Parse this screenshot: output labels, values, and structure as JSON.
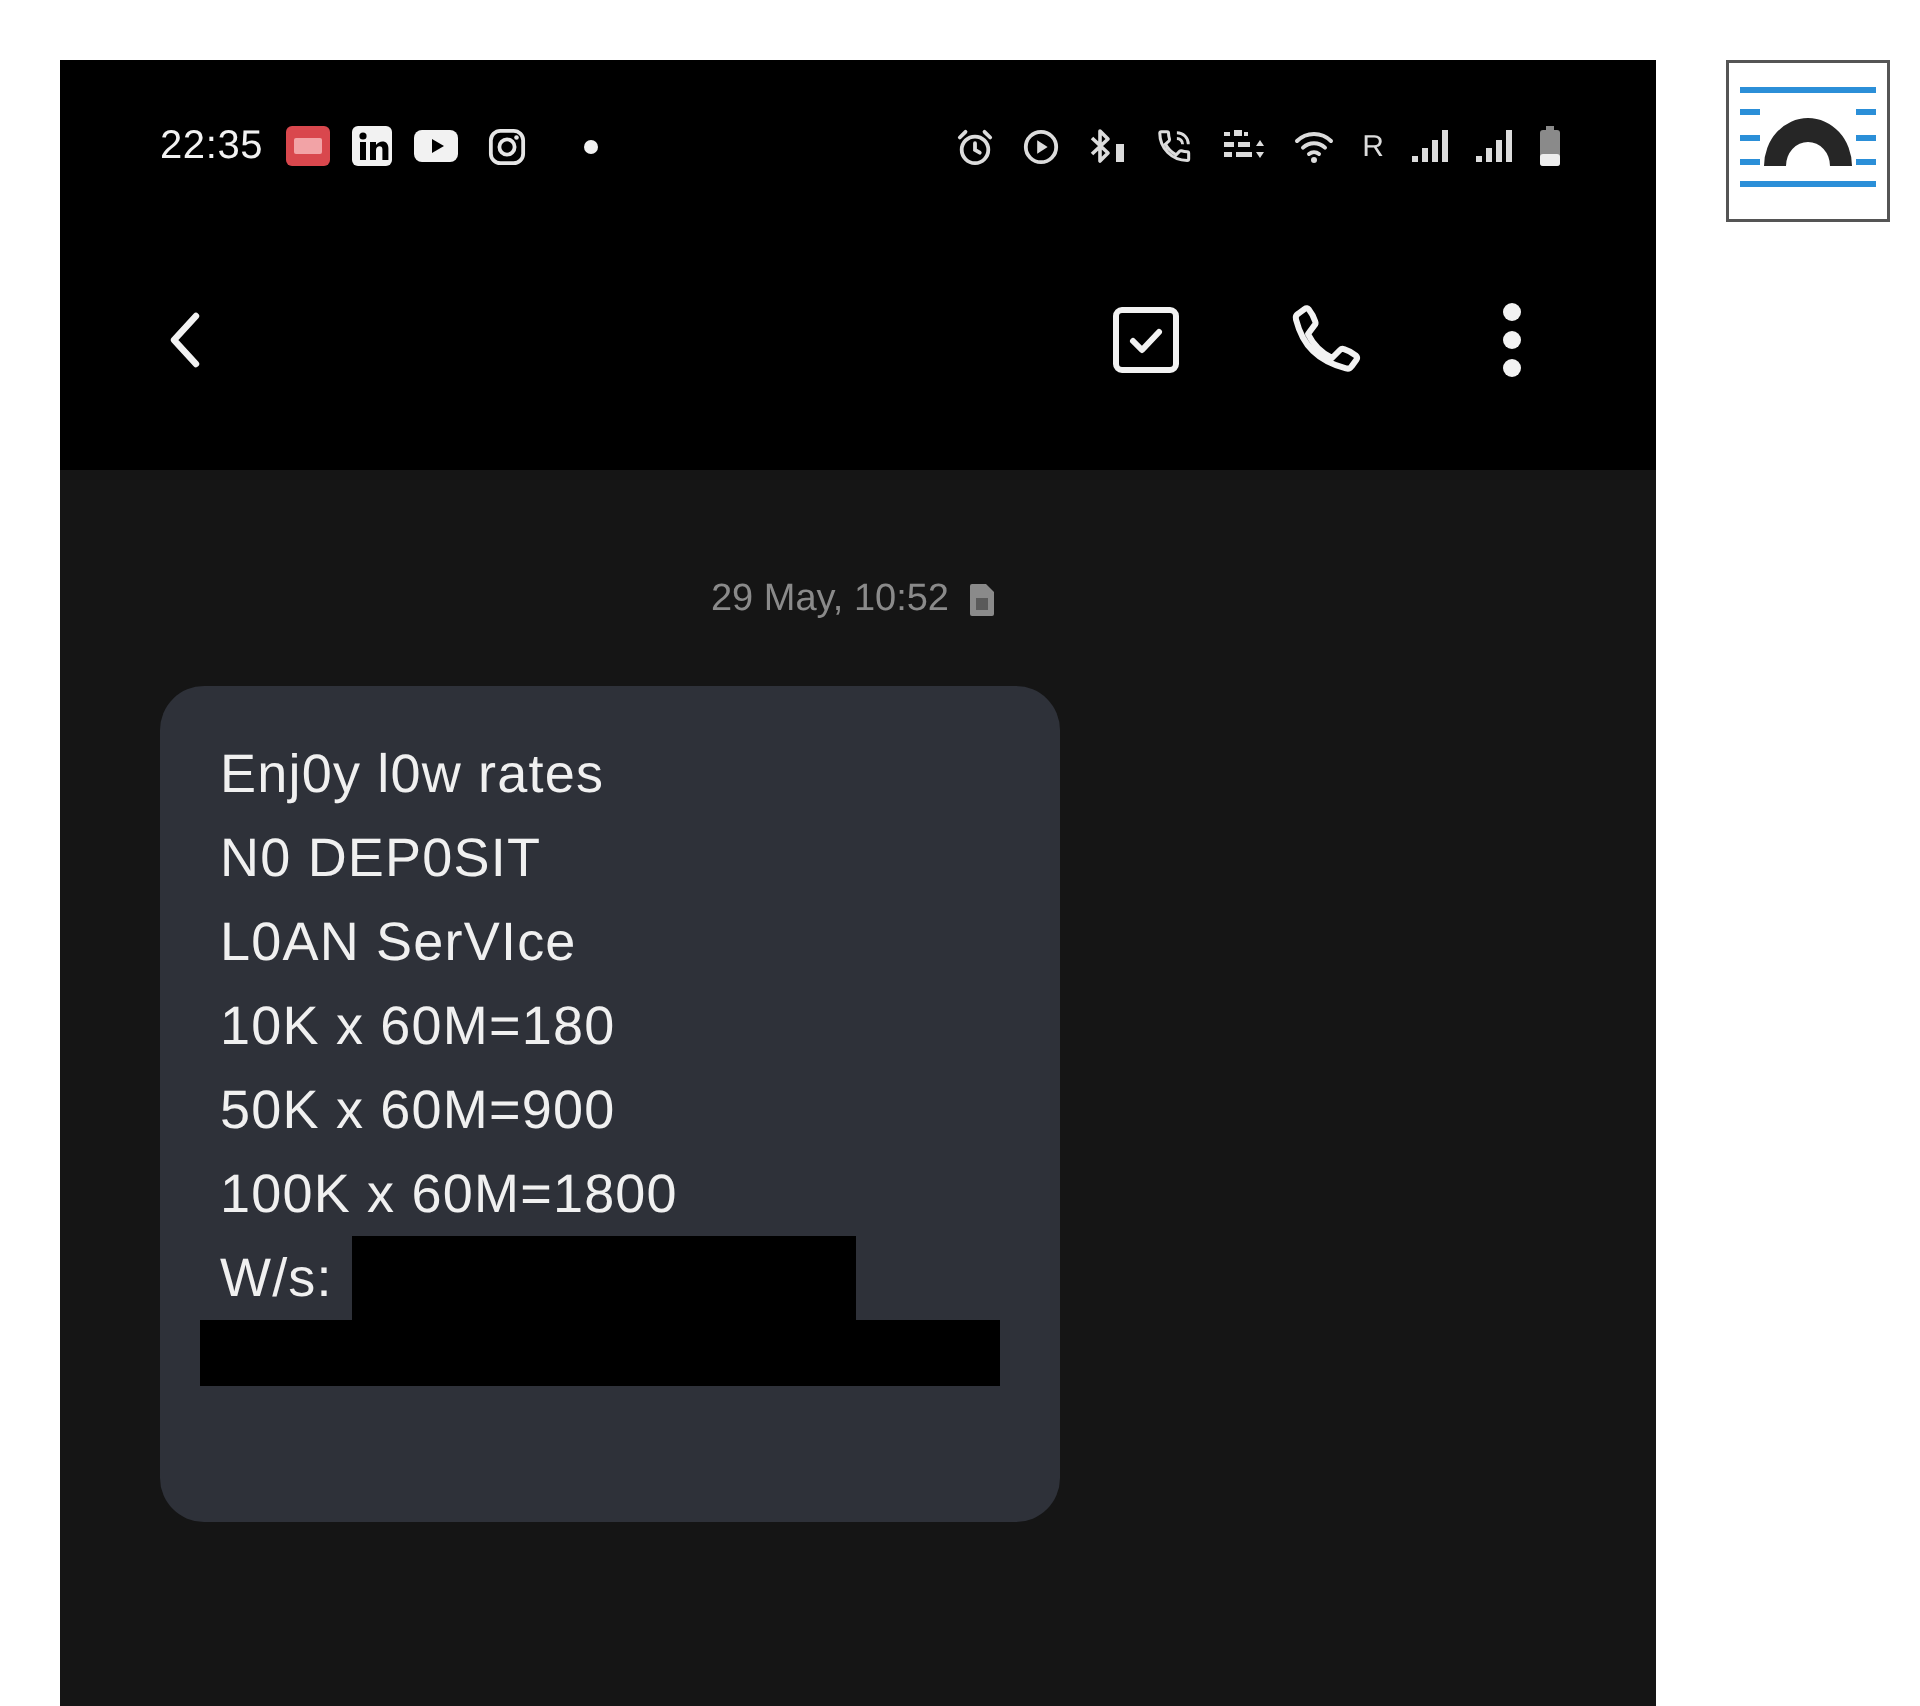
{
  "status_bar": {
    "time": "22:35",
    "roaming_label": "R"
  },
  "conversation": {
    "timestamp": "29 May, 10:52",
    "message": {
      "lines": [
        {
          "kind": "text",
          "text": "Enj0y l0w rates"
        },
        {
          "kind": "text",
          "text": "N0 DEP0SIT"
        },
        {
          "kind": "text",
          "text": "L0AN SerVIce"
        },
        {
          "kind": "text",
          "text": "10K x 60M=180"
        },
        {
          "kind": "text",
          "text": "50K x 60M=900"
        },
        {
          "kind": "text",
          "text": "100K x 60M=1800"
        },
        {
          "kind": "text_with_redaction",
          "text": "W/s:"
        },
        {
          "kind": "redaction"
        }
      ]
    }
  }
}
